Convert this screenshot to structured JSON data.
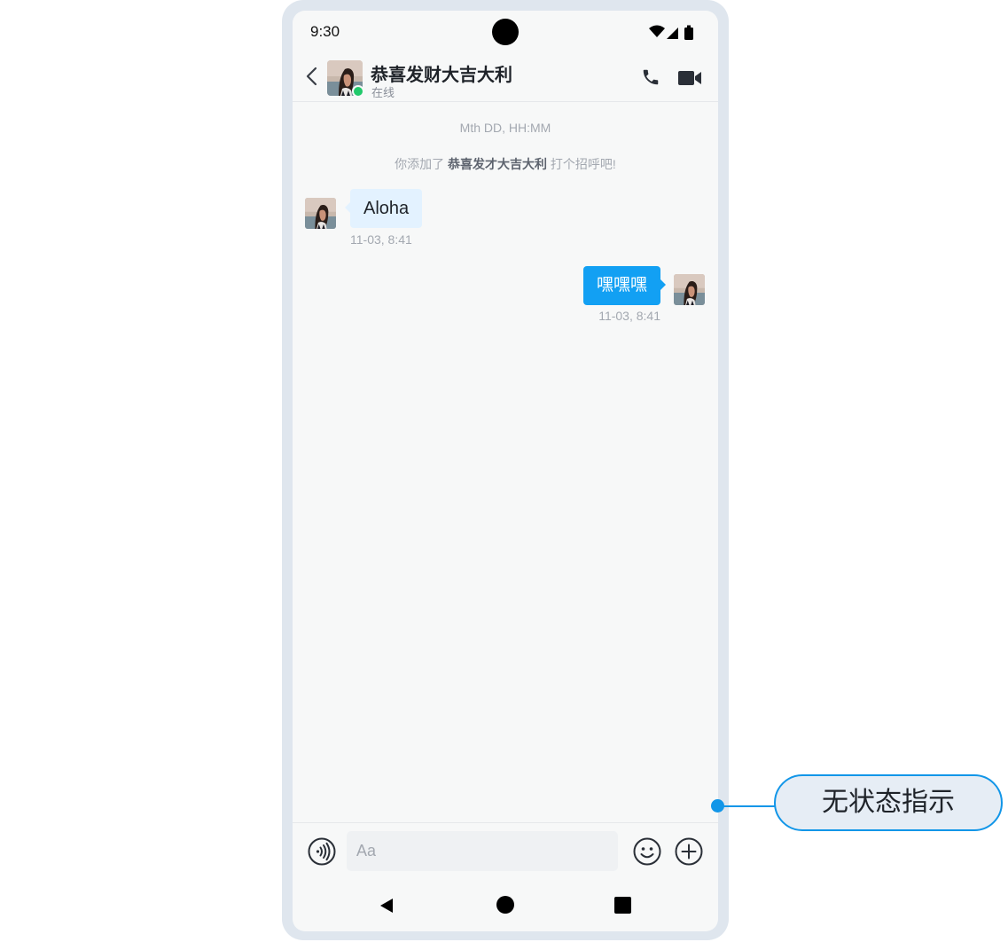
{
  "status_bar": {
    "time": "9:30"
  },
  "header": {
    "contact_name": "恭喜发财大吉大利",
    "contact_status": "在线"
  },
  "chat": {
    "date_placeholder": "Mth DD, HH:MM",
    "system_notice": {
      "prefix": "你添加了 ",
      "name": "恭喜发才大吉大利",
      "suffix": " 打个招呼吧!"
    },
    "messages": [
      {
        "direction": "incoming",
        "text": "Aloha",
        "time": "11-03, 8:41"
      },
      {
        "direction": "outgoing",
        "text": "嘿嘿嘿",
        "time": "11-03, 8:41"
      }
    ]
  },
  "input_bar": {
    "placeholder": "Aa"
  },
  "annotation": {
    "label": "无状态指示"
  },
  "colors": {
    "accent": "#12a0f3",
    "incoming_bubble": "#e3f2ff",
    "online": "#21c96b",
    "callout": "#1296e8"
  },
  "icons": {
    "back": "chevron-left-icon",
    "call": "phone-icon",
    "video": "video-camera-icon",
    "voice": "voice-icon",
    "emoji": "emoji-icon",
    "more": "plus-circle-icon"
  }
}
